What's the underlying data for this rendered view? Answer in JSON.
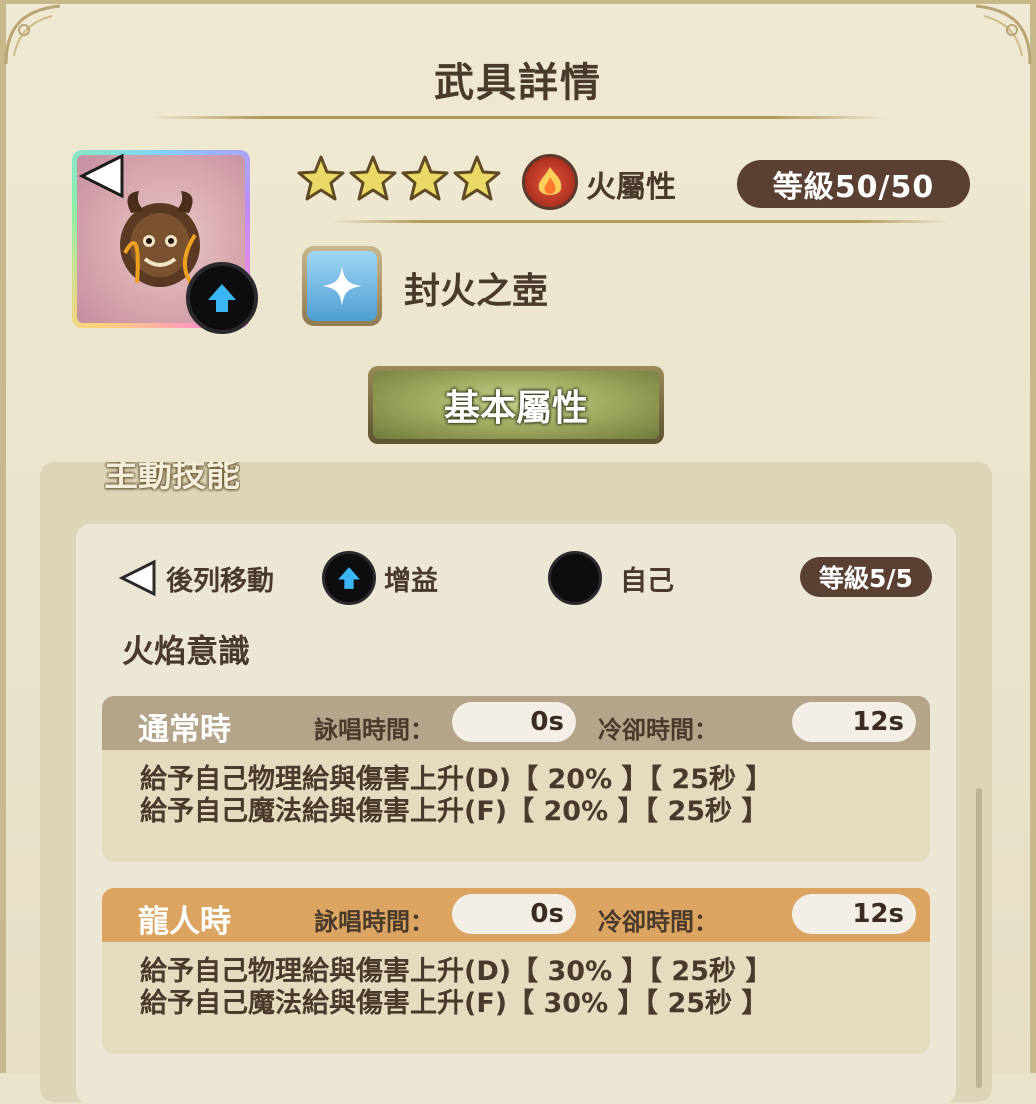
{
  "header": {
    "title": "武具詳情"
  },
  "weapon": {
    "stars": 4,
    "attribute": "火屬性",
    "level": "等級50/50",
    "name": "封火之壺"
  },
  "tab_button": "基本屬性",
  "skill_section": {
    "title": "主動技能",
    "tags": [
      {
        "icon": "back-row-move-icon",
        "label": "後列移動"
      },
      {
        "icon": "buff-arrow-icon",
        "label": "增益"
      },
      {
        "icon": "self-target-icon",
        "label": "自己"
      }
    ],
    "level": "等級5/5",
    "skill_name": "火焰意識",
    "modes": [
      {
        "label": "通常時",
        "cast_label": "詠唱時間：",
        "cast_value": "0s",
        "cooldown_label": "冷卻時間：",
        "cooldown_value": "12s",
        "lines": [
          "給予自己物理給與傷害上升(D)【 20% 】【 25秒 】",
          "給予自己魔法給與傷害上升(F)【 20% 】【 25秒 】"
        ]
      },
      {
        "label": "龍人時",
        "cast_label": "詠唱時間：",
        "cast_value": "0s",
        "cooldown_label": "冷卻時間：",
        "cooldown_value": "12s",
        "lines": [
          "給予自己物理給與傷害上升(D)【 30% 】【 25秒 】",
          "給予自己魔法給與傷害上升(F)【 30% 】【 25秒 】"
        ]
      }
    ]
  },
  "colors": {
    "level_pill": "#5a3f33",
    "normal_header": "#b3a48a",
    "dragon_header": "#dba461"
  }
}
